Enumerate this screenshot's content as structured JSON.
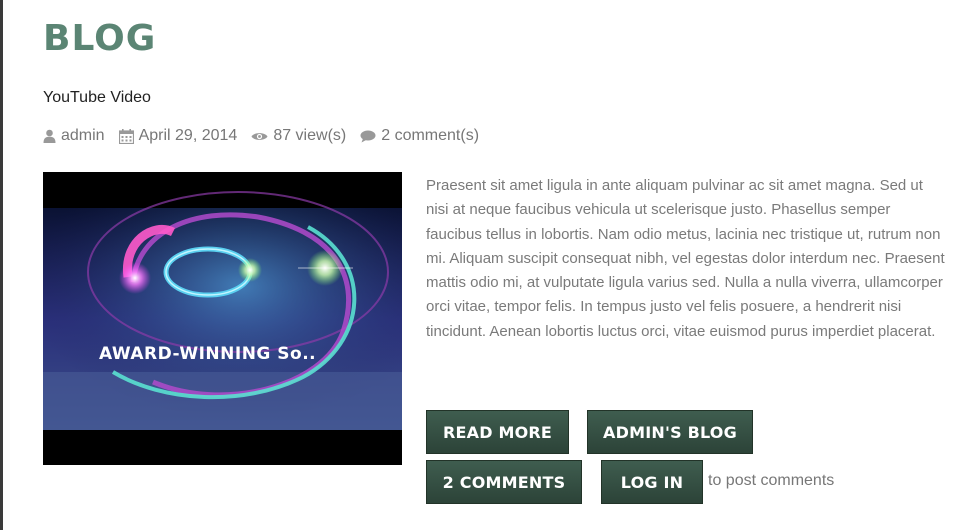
{
  "page": {
    "title": "BLOG"
  },
  "post": {
    "title": "YouTube Video",
    "meta": {
      "author": "admin",
      "date": "April 29, 2014",
      "views": "87 view(s)",
      "comments": "2 comment(s)"
    },
    "thumbnail": {
      "caption": "AWARD-WINNING So..",
      "icon": "video-thumbnail"
    },
    "excerpt": "Praesent sit amet ligula in ante aliquam pulvinar ac sit amet magna. Sed ut nisi at neque faucibus vehicula ut scelerisque justo. Phasellus semper faucibus tellus in lobortis. Nam odio metus, lacinia nec tristique ut, rutrum non mi. Aliquam suscipit consequat nibh, vel egestas dolor interdum nec. Praesent mattis odio mi, at vulputate ligula varius sed. Nulla a nulla viverra, ullamcorper orci vitae, tempor felis. In tempus justo vel felis posuere, a hendrerit nisi tincidunt. Aenean lobortis luctus orci, vitae euismod purus imperdiet placerat."
  },
  "actions": {
    "read_more": "READ MORE",
    "admins_blog": "ADMIN'S BLOG",
    "comments": "2 COMMENTS",
    "log_in": "LOG IN",
    "post_comments_note": "to post comments"
  },
  "colors": {
    "title": "#5b8574",
    "button": "#34503f",
    "meta_text": "#777777"
  }
}
